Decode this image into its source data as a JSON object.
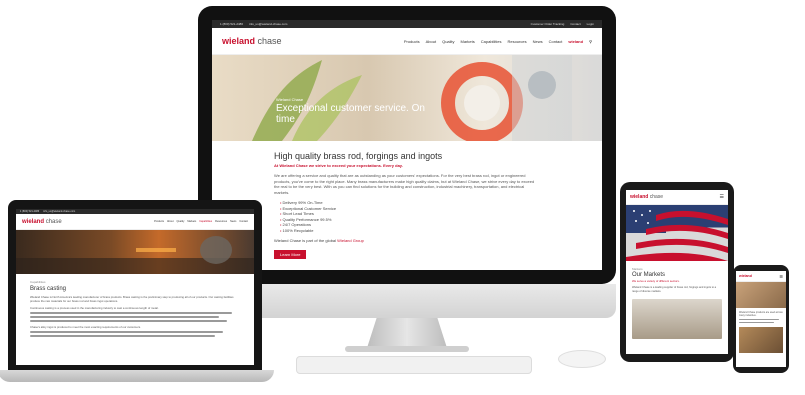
{
  "site": {
    "logo_brand": "wieland",
    "logo_suffix": "chase",
    "top_bar": {
      "phone": "1 (800) 521-2486",
      "email": "info_us@wieland-chase.com"
    },
    "utility_links": [
      "Customer Order Tracking",
      "Contact",
      "Login"
    ],
    "nav": [
      "Products",
      "About",
      "Quality",
      "Markets",
      "Capabilities",
      "Resources",
      "News",
      "Contact"
    ]
  },
  "imac": {
    "hero_kicker": "Wieland Chase",
    "hero_title": "Exceptional customer service. On time",
    "heading": "High quality brass rod, forgings and ingots",
    "subheading": "At Wieland Chase we strive to exceed your expectations. Every day.",
    "paragraph": "We are offering a service and quality that are as outstanding as your customers' expectations. For the very best brass rod, ingot or engineered products, you've come to the right place. Many brass manufacturers make high quality claims, but at Wieland Chase, we strive every day to exceed the real to be the very best. With us you can find solutions for the building and construction, industrial machinery, transportation, and electrical markets.",
    "bullets": [
      "Delivery 99% On-Time",
      "Exceptional Customer Service",
      "Short Lead Times",
      "Quality Performance 99.5%",
      "24/7 Operations",
      "100% Recyclable"
    ],
    "group_note_prefix": "Wieland Chase is part of the global",
    "group_note_link": "Wieland Group",
    "cta_label": "Learn More"
  },
  "laptop": {
    "breadcrumb": "Capabilities",
    "heading": "Brass casting",
    "paragraph_1": "Wieland Chase is North America's leading manufacturer of brass products. Brass casting is the preliminary step to producing all of our products. Our casting facilities produce the raw materials for our brass rod and brass ingot operations.",
    "paragraph_2": "Continuous casting is a process used in the manufacturing industry to cast a continuous length of metal.",
    "paragraph_3": "Chase's alloy ingot is produced to meet the most exacting requirements of our customers."
  },
  "tablet": {
    "section_label": "Markets",
    "heading": "Our Markets",
    "subheading": "We serve a variety of different sectors.",
    "body": "Wieland Chase is a leading supplier of brass rod, forgings and ingots to a range of diverse markets."
  },
  "phone": {
    "body": "Wieland Chase products are used across many industries."
  },
  "colors": {
    "brand_red": "#c8102e",
    "bezel": "#111111",
    "text_dark": "#333333"
  }
}
